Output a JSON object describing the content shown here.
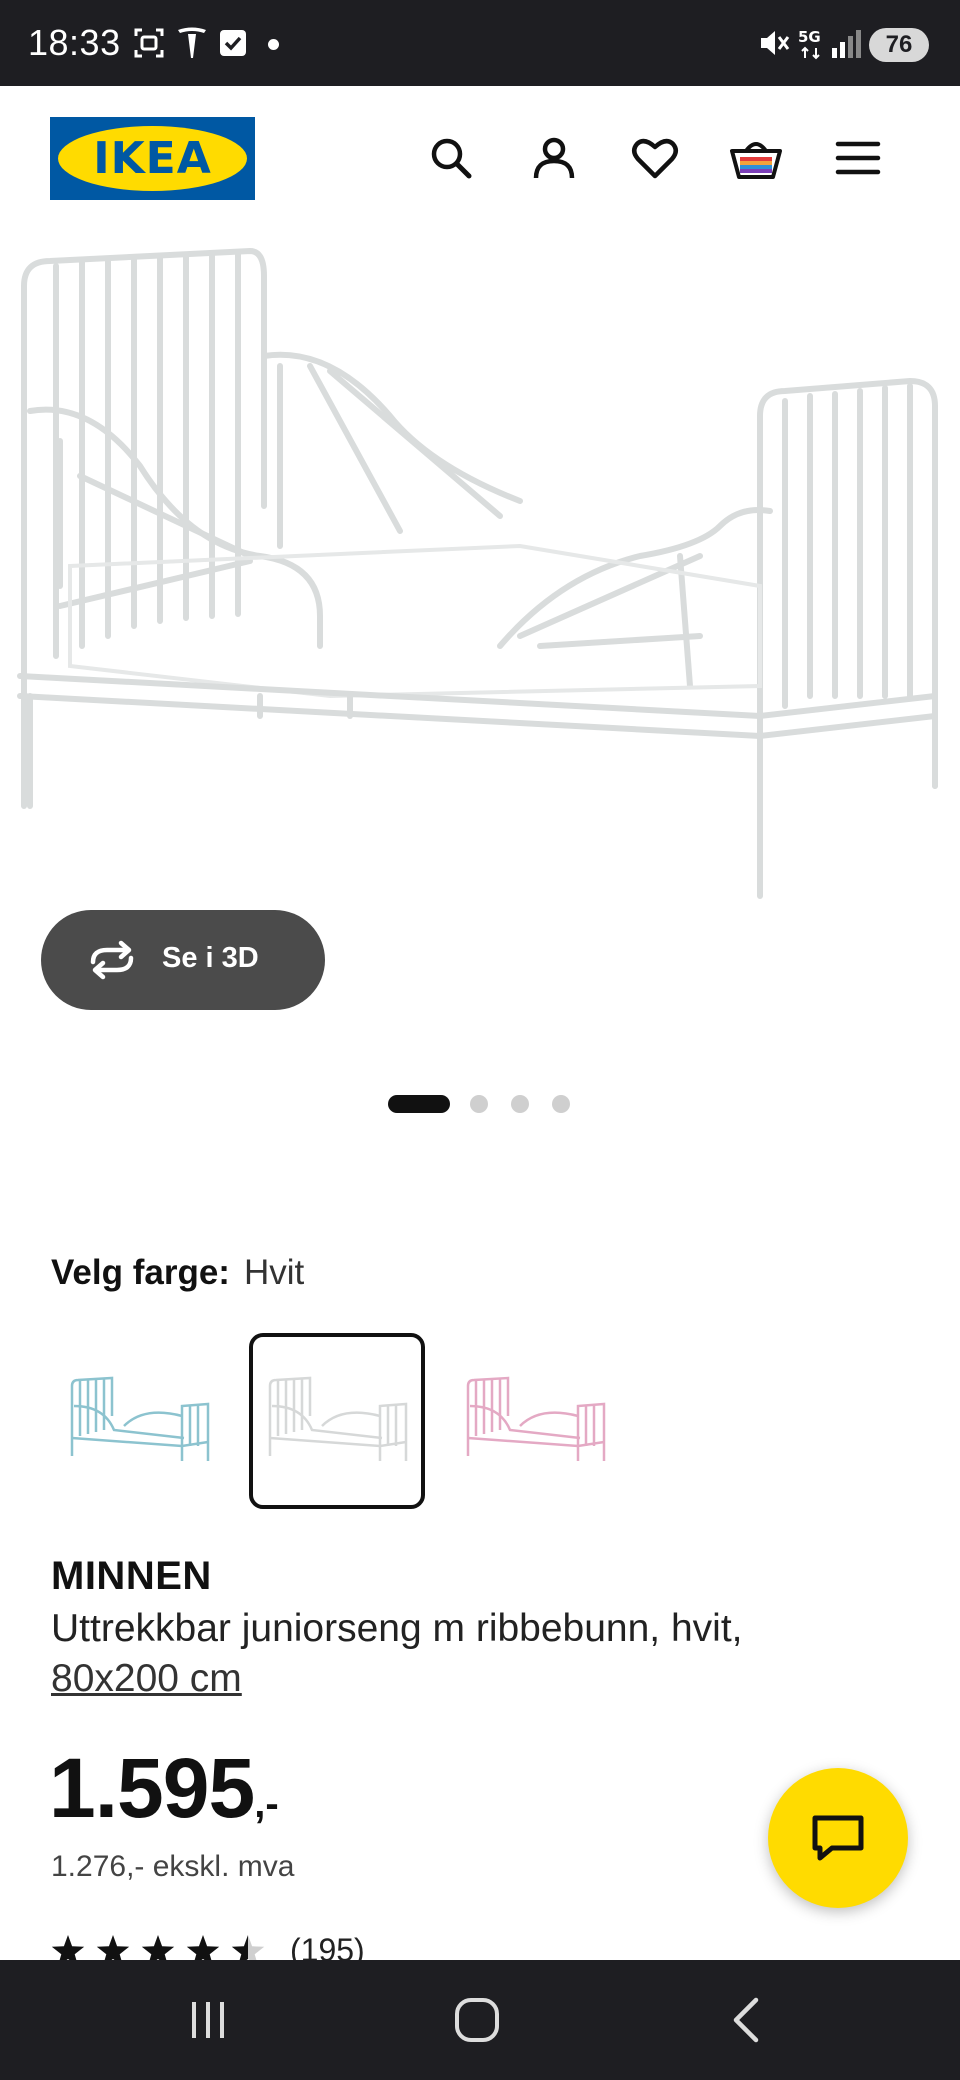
{
  "status_bar": {
    "time": "18:33",
    "battery": "76",
    "icons": [
      "screenshot-icon",
      "tesla-icon",
      "checkbox-icon",
      "notification-dot",
      "mute-icon",
      "5g-icon",
      "signal-icon",
      "battery-icon"
    ]
  },
  "header": {
    "logo_text": "IKEA",
    "icons": [
      "search-icon",
      "account-icon",
      "heart-icon",
      "basket-icon",
      "menu-icon"
    ]
  },
  "product_image": {
    "view_3d_label": "Se i 3D",
    "carousel_total": 4,
    "carousel_active": 1
  },
  "color_picker": {
    "label": "Velg farge:",
    "selected": "Hvit",
    "options": [
      "turquoise",
      "white",
      "pink"
    ]
  },
  "product": {
    "name": "MINNEN",
    "description": "Uttrekkbar juniorseng m ribbebunn, hvit,",
    "size": "80x200 cm",
    "price_main": "1.595",
    "price_suffix": ",-",
    "price_ex_vat": "1.276,- ekskl. mva",
    "rating": 4.5,
    "review_count": "(195)"
  },
  "colors": {
    "ikea_blue": "#0058a3",
    "ikea_yellow": "#ffdb00",
    "status_bg": "#1e1e22",
    "btn_3d_bg": "#4b4b4b"
  }
}
